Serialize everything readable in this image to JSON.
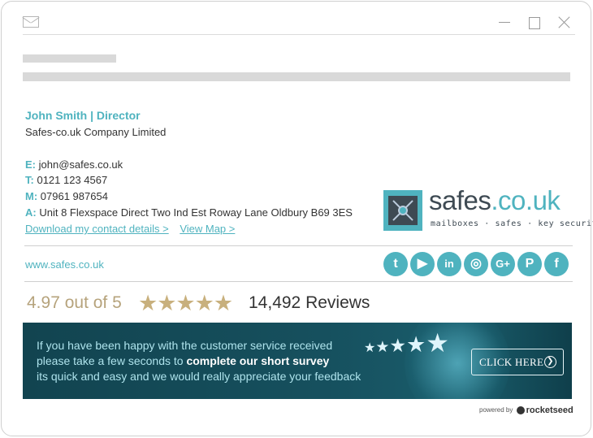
{
  "signature": {
    "name_title": "John Smith | Director",
    "company": "Safes-co.uk Company Limited",
    "contacts": [
      {
        "label": "E:",
        "value": "john@safes.co.uk"
      },
      {
        "label": "T:",
        "value": "0121 123 4567"
      },
      {
        "label": "M:",
        "value": "07961 987654"
      },
      {
        "label": "A:",
        "value": "Unit 8 Flexspace Direct Two Ind Est Roway Lane Oldbury B69 3ES"
      }
    ],
    "download_link": "Download my contact details >",
    "map_link": "View Map >",
    "website": "www.safes.co.uk"
  },
  "logo": {
    "word": "safes",
    "tld": ".co.uk",
    "tagline": "mailboxes · safes · key security"
  },
  "social": [
    {
      "name": "twitter-icon",
      "glyph": "t"
    },
    {
      "name": "youtube-icon",
      "glyph": "▶"
    },
    {
      "name": "linkedin-icon",
      "glyph": "in"
    },
    {
      "name": "instagram-icon",
      "glyph": "◎"
    },
    {
      "name": "google-plus-icon",
      "glyph": "G+"
    },
    {
      "name": "pinterest-icon",
      "glyph": "P"
    },
    {
      "name": "facebook-icon",
      "glyph": "f"
    }
  ],
  "reviews": {
    "score_text": "4.97 out of 5",
    "stars": "★★★★★",
    "count_text": "14,492 Reviews"
  },
  "banner": {
    "line1": "If you have been happy with the customer service received",
    "line2_prefix": "please take a few seconds to ",
    "line2_bold": "complete our short survey",
    "line3": "its quick and easy and we would really appreciate your feedback",
    "cta": "CLICK HERE",
    "cta_arrow": "❯"
  },
  "powered_by": {
    "prefix": "powered by",
    "brand": "rocketseed"
  },
  "colors": {
    "accent": "#4fb3bf",
    "star_gold": "#c8b07d",
    "banner_bg": "#16505e"
  }
}
